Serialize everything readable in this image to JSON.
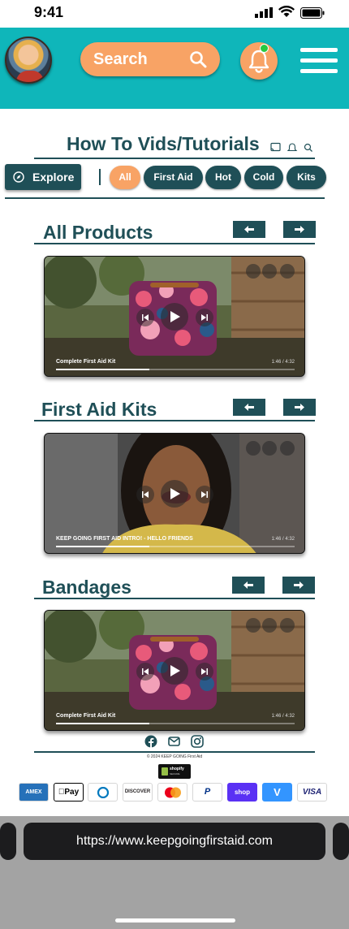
{
  "status_bar": {
    "time": "9:41"
  },
  "header": {
    "search_label": "Search"
  },
  "page": {
    "title": "How To Vids/Tutorials"
  },
  "filters": {
    "explore_label": "Explore",
    "chips": [
      {
        "label": "All",
        "active": true
      },
      {
        "label": "First Aid",
        "active": false
      },
      {
        "label": "Hot",
        "active": false
      },
      {
        "label": "Cold",
        "active": false
      },
      {
        "label": "Kits",
        "active": false
      }
    ]
  },
  "sections": [
    {
      "title": "All Products",
      "video": {
        "title": "Complete First Aid Kit",
        "time": "1:46 / 4:32",
        "progress": 0.39
      }
    },
    {
      "title": "First Aid Kits",
      "video": {
        "title": "KEEP GOING FIRST AID INTRO! - HELLO FRIENDS",
        "time": "1:46 / 4:32",
        "progress": 0.39
      }
    },
    {
      "title": "Bandages",
      "video": {
        "title": "Complete First Aid Kit",
        "time": "1:46 / 4:32",
        "progress": 0.39
      }
    }
  ],
  "footer": {
    "copyright": "© 2024 KEEP GOING First Aid",
    "shopify_badge": {
      "name": "shopify",
      "sub": "SECURE"
    },
    "payment_methods": [
      {
        "label": "AMEX",
        "color": "#2671b9"
      },
      {
        "label": "Pay",
        "color": "#000000"
      },
      {
        "label": "D",
        "color": "#0079be"
      },
      {
        "label": "DISCOVER",
        "color": "#231f20"
      },
      {
        "label": "",
        "color": "#eb001b"
      },
      {
        "label": "P",
        "color": "#003087"
      },
      {
        "label": "shop",
        "color": "#5a31f4"
      },
      {
        "label": "V",
        "color": "#3395ff"
      },
      {
        "label": "VISA",
        "color": "#1a1f71"
      }
    ]
  },
  "browser": {
    "url": "https://www.keepgoingfirstaid.com"
  },
  "colors": {
    "teal": "#0fb6ba",
    "orange": "#f8a365",
    "dark_teal": "#1f4f57"
  }
}
